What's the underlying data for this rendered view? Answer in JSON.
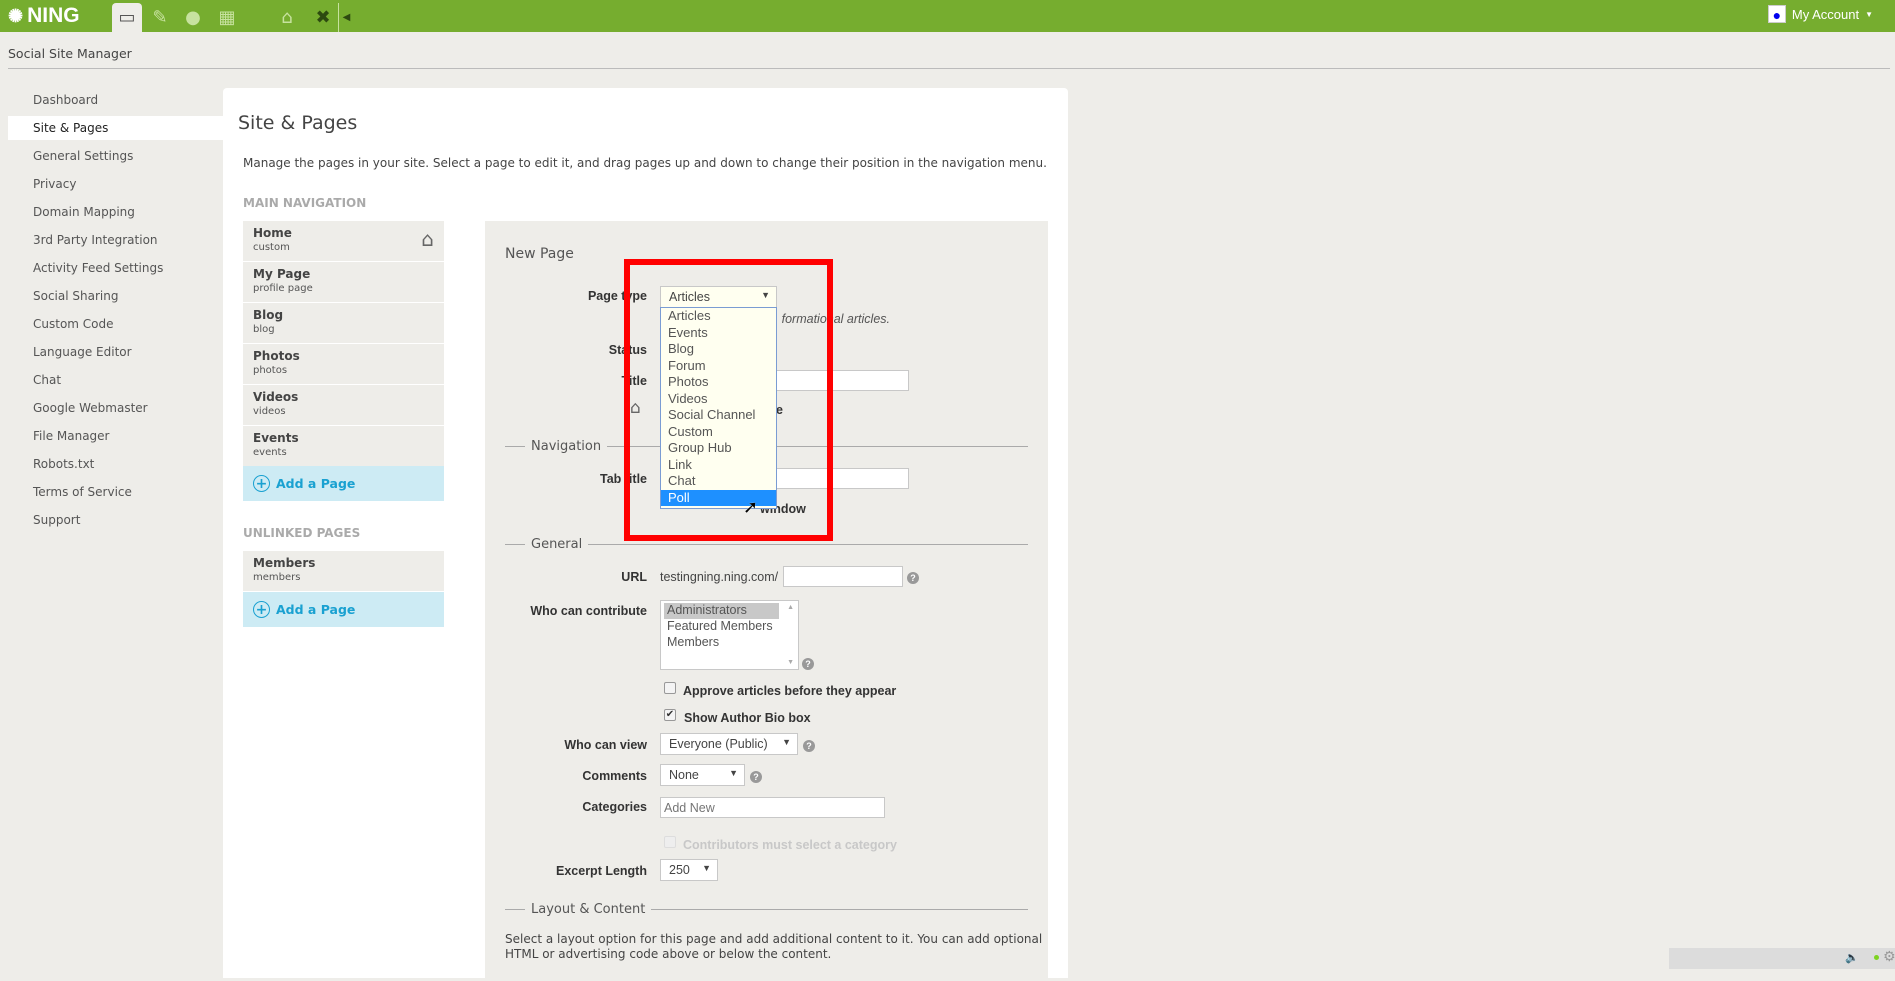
{
  "topbar": {
    "logo": "NING",
    "icons": [
      "browser-window-icon",
      "appearance-icon",
      "person-icon",
      "grid-icon",
      "home-icon",
      "tools-icon",
      "collapse-arrow-icon"
    ],
    "account": "My Account",
    "color": "#76ad2f"
  },
  "header": {
    "title": "Social Site Manager"
  },
  "sidebar": {
    "items": [
      {
        "label": "Dashboard"
      },
      {
        "label": "Site & Pages",
        "selected": true
      },
      {
        "label": "General Settings"
      },
      {
        "label": "Privacy"
      },
      {
        "label": "Domain Mapping"
      },
      {
        "label": "3rd Party Integration"
      },
      {
        "label": "Activity Feed Settings"
      },
      {
        "label": "Social Sharing"
      },
      {
        "label": "Custom Code"
      },
      {
        "label": "Language Editor"
      },
      {
        "label": "Chat"
      },
      {
        "label": "Google Webmaster"
      },
      {
        "label": "File Manager"
      },
      {
        "label": "Robots.txt"
      },
      {
        "label": "Terms of Service"
      },
      {
        "label": "Support"
      }
    ]
  },
  "main": {
    "title": "Site & Pages",
    "description": "Manage the pages in your site. Select a page to edit it, and drag pages up and down to change their position in the navigation menu.",
    "main_nav_heading": "MAIN NAVIGATION",
    "main_nav": [
      {
        "name": "Home",
        "type": "custom"
      },
      {
        "name": "My Page",
        "type": "profile page"
      },
      {
        "name": "Blog",
        "type": "blog"
      },
      {
        "name": "Photos",
        "type": "photos"
      },
      {
        "name": "Videos",
        "type": "videos"
      },
      {
        "name": "Events",
        "type": "events"
      }
    ],
    "add_page": "Add a Page",
    "unlinked_heading": "UNLINKED PAGES",
    "unlinked": [
      {
        "name": "Members",
        "type": "members"
      }
    ]
  },
  "form": {
    "title": "New Page",
    "page_type_label": "Page type",
    "page_type_value": "Articles",
    "page_type_options": [
      "Articles",
      "Events",
      "Blog",
      "Forum",
      "Photos",
      "Videos",
      "Social Channel",
      "Custom",
      "Group Hub",
      "Link",
      "Chat",
      "Poll"
    ],
    "highlighted_option": "Poll",
    "page_type_desc_fragment": "formational articles.",
    "status_label": "Status",
    "title_label": "Title",
    "home_fragment": "e",
    "navigation_legend": "Navigation",
    "tab_title_label": "Tab title",
    "new_window_fragment": "window",
    "general_legend": "General",
    "url_label": "URL",
    "url_prefix": "testingning.ning.com/",
    "contribute_label": "Who can contribute",
    "contribute_options": [
      "Administrators",
      "Featured Members",
      "Members"
    ],
    "contribute_selected": "Administrators",
    "approve_label": "Approve articles before they appear",
    "approve_checked": false,
    "bio_label": "Show Author Bio box",
    "bio_checked": true,
    "view_label": "Who can view",
    "view_value": "Everyone (Public)",
    "comments_label": "Comments",
    "comments_value": "None",
    "categories_label": "Categories",
    "categories_placeholder": "Add New",
    "must_select_label": "Contributors must select a category",
    "excerpt_label": "Excerpt Length",
    "excerpt_value": "250",
    "layout_legend": "Layout & Content",
    "layout_desc_1": "Select a layout option for this page and add additional content to it. You can add optional",
    "layout_desc_2": "HTML or advertising code above or below the content."
  },
  "highlight_color": "#ff0000"
}
